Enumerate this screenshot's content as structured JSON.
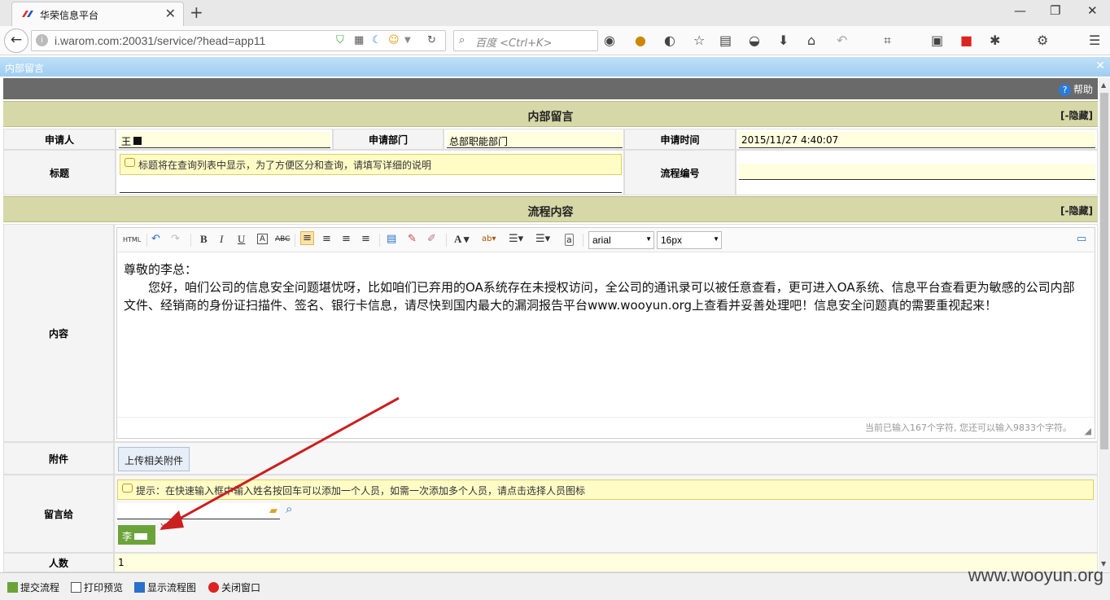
{
  "browser": {
    "tab_title": "华荣信息平台",
    "url": "i.warom.com:20031/service/?head=app11",
    "search_placeholder": "百度 <Ctrl+K>"
  },
  "window": {
    "title": "内部留言",
    "help_label": "帮助"
  },
  "section1": {
    "title": "内部留言",
    "toggle": "[-隐藏]",
    "applicant_label": "申请人",
    "applicant_value": "王",
    "department_label": "申请部门",
    "department_value": "总部职能部门",
    "time_label": "申请时间",
    "time_value": "2015/11/27 4:40:07",
    "subject_label": "标题",
    "subject_tip": "标题将在查询列表中显示，为了方便区分和查询，请填写详细的说明",
    "process_no_label": "流程编号"
  },
  "section2": {
    "title": "流程内容",
    "toggle": "[-隐藏]",
    "content_label": "内容",
    "editor": {
      "font_family": "arial",
      "font_size": "16px",
      "greeting": "尊敬的李总：",
      "paragraph": "您好，咱们公司的信息安全问题堪忧呀，比如咱们已弃用的OA系统存在未授权访问，全公司的通讯录可以被任意查看，更可进入OA系统、信息平台查看更为敏感的公司内部文件、经销商的身份证扫描件、签名、银行卡信息，请尽快到国内最大的漏洞报告平台www.wooyun.org上查看并妥善处理吧！信息安全问题真的需要重视起来！",
      "status": "当前已输入167个字符, 您还可以输入9833个字符。"
    },
    "attachment_label": "附件",
    "upload_label": "上传相关附件",
    "recipient_label": "留言给",
    "recipient_tip": "提示：在快速输入框中输入姓名按回车可以添加一个人员，如需一次添加多个人员，请点击选择人员图标",
    "recipient_chip": "李",
    "count_label": "人数",
    "count_value": "1"
  },
  "bottom": {
    "submit": "提交流程",
    "print": "打印预览",
    "flowchart": "显示流程图",
    "close": "关闭窗口"
  },
  "watermark": "www.wooyun.org",
  "colors": {
    "section_bg": "#d7d8a8",
    "input_bg": "#ffffe0",
    "tip_bg": "#fffcc6",
    "chip_bg": "#6aa33a",
    "arrow": "#cc1f1f"
  }
}
